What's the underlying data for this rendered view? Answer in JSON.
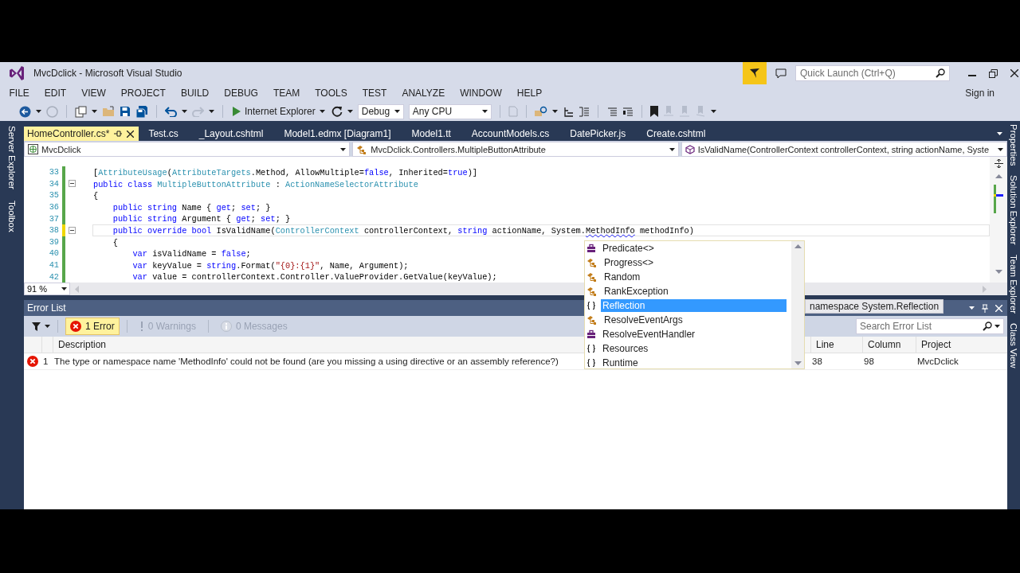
{
  "window": {
    "title": "MvcDclick - Microsoft Visual Studio"
  },
  "quick_launch": {
    "placeholder": "Quick Launch (Ctrl+Q)"
  },
  "menu": [
    "FILE",
    "EDIT",
    "VIEW",
    "PROJECT",
    "BUILD",
    "DEBUG",
    "TEAM",
    "TOOLS",
    "TEST",
    "ANALYZE",
    "WINDOW",
    "HELP"
  ],
  "sign_in": "Sign in",
  "toolbar": {
    "run_target": "Internet Explorer",
    "configuration": "Debug",
    "platform": "Any CPU"
  },
  "left_tool_tabs": [
    "Server Explorer",
    "Toolbox"
  ],
  "right_tool_tabs": [
    "Properties",
    "Solution Explorer",
    "Team Explorer",
    "Class View"
  ],
  "document_tabs": [
    {
      "label": "HomeController.cs*",
      "selected": true
    },
    {
      "label": "Test.cs",
      "selected": false
    },
    {
      "label": "_Layout.cshtml",
      "selected": false
    },
    {
      "label": "Model1.edmx [Diagram1]",
      "selected": false
    },
    {
      "label": "Model1.tt",
      "selected": false
    },
    {
      "label": "AccountModels.cs",
      "selected": false
    },
    {
      "label": "DatePicker.js",
      "selected": false
    },
    {
      "label": "Create.cshtml",
      "selected": false
    }
  ],
  "nav_bar": [
    "MvcDclick",
    "MvcDclick.Controllers.MultipleButtonAttribute",
    "IsValidName(ControllerContext controllerContext, string actionName, Syste"
  ],
  "editor": {
    "zoom": "91 %",
    "lines": [
      {
        "number": "33",
        "unsaved": false,
        "fold_marker": false,
        "current": false,
        "tokens": [
          {
            "kind": "plain",
            "text": "["
          },
          {
            "kind": "type",
            "text": "AttributeUsage"
          },
          {
            "kind": "plain",
            "text": "("
          },
          {
            "kind": "type",
            "text": "AttributeTargets"
          },
          {
            "kind": "plain",
            "text": ".Method, AllowMultiple="
          },
          {
            "kind": "kw",
            "text": "false"
          },
          {
            "kind": "plain",
            "text": ", Inherited="
          },
          {
            "kind": "kw",
            "text": "true"
          },
          {
            "kind": "plain",
            "text": ")]"
          }
        ]
      },
      {
        "number": "34",
        "unsaved": false,
        "fold_marker": true,
        "current": false,
        "tokens": [
          {
            "kind": "kw",
            "text": "public class"
          },
          {
            "kind": "type",
            "text": " MultipleButtonAttribute"
          },
          {
            "kind": "plain",
            "text": " : "
          },
          {
            "kind": "type",
            "text": "ActionNameSelectorAttribute"
          }
        ]
      },
      {
        "number": "35",
        "unsaved": false,
        "fold_marker": false,
        "current": false,
        "tokens": [
          {
            "kind": "plain",
            "text": "{"
          }
        ]
      },
      {
        "number": "36",
        "unsaved": false,
        "fold_marker": false,
        "current": false,
        "tokens": [
          {
            "kind": "kw",
            "text": "    public string"
          },
          {
            "kind": "plain",
            "text": " Name { "
          },
          {
            "kind": "kw",
            "text": "get"
          },
          {
            "kind": "plain",
            "text": "; "
          },
          {
            "kind": "kw",
            "text": "set"
          },
          {
            "kind": "plain",
            "text": "; }"
          }
        ]
      },
      {
        "number": "37",
        "unsaved": false,
        "fold_marker": false,
        "current": false,
        "tokens": [
          {
            "kind": "kw",
            "text": "    public string"
          },
          {
            "kind": "plain",
            "text": " Argument { "
          },
          {
            "kind": "kw",
            "text": "get"
          },
          {
            "kind": "plain",
            "text": "; "
          },
          {
            "kind": "kw",
            "text": "set"
          },
          {
            "kind": "plain",
            "text": "; }"
          }
        ]
      },
      {
        "number": "38",
        "unsaved": true,
        "fold_marker": true,
        "current": true,
        "tokens": [
          {
            "kind": "kw",
            "text": "    public override bool"
          },
          {
            "kind": "plain",
            "text": " IsValidName("
          },
          {
            "kind": "type",
            "text": "ControllerContext"
          },
          {
            "kind": "plain",
            "text": " controllerContext, "
          },
          {
            "kind": "kw",
            "text": "string"
          },
          {
            "kind": "plain",
            "text": " actionName, System."
          },
          {
            "kind": "error",
            "text": "MethodInfo"
          },
          {
            "kind": "plain",
            "text": " methodInfo)"
          }
        ]
      },
      {
        "number": "39",
        "unsaved": false,
        "fold_marker": false,
        "current": false,
        "tokens": [
          {
            "kind": "plain",
            "text": "    {"
          }
        ]
      },
      {
        "number": "40",
        "unsaved": false,
        "fold_marker": false,
        "current": false,
        "tokens": [
          {
            "kind": "kw",
            "text": "        var"
          },
          {
            "kind": "plain",
            "text": " isValidName = "
          },
          {
            "kind": "kw",
            "text": "false"
          },
          {
            "kind": "plain",
            "text": ";"
          }
        ]
      },
      {
        "number": "41",
        "unsaved": false,
        "fold_marker": false,
        "current": false,
        "tokens": [
          {
            "kind": "kw",
            "text": "        var"
          },
          {
            "kind": "plain",
            "text": " keyValue = "
          },
          {
            "kind": "kw",
            "text": "string"
          },
          {
            "kind": "plain",
            "text": ".Format("
          },
          {
            "kind": "str",
            "text": "\"{0}:{1}\""
          },
          {
            "kind": "plain",
            "text": ", Name, Argument);"
          }
        ]
      },
      {
        "number": "42",
        "unsaved": false,
        "fold_marker": false,
        "current": false,
        "tokens": [
          {
            "kind": "kw",
            "text": "        var"
          },
          {
            "kind": "plain",
            "text": " value = controllerContext.Controller.ValueProvider.GetValue(keyValue);"
          }
        ]
      }
    ]
  },
  "completion": {
    "items": [
      {
        "label": "Predicate<>",
        "kind": "delegate",
        "selected": false
      },
      {
        "label": "Progress<>",
        "kind": "class",
        "selected": false
      },
      {
        "label": "Random",
        "kind": "class",
        "selected": false
      },
      {
        "label": "RankException",
        "kind": "class",
        "selected": false
      },
      {
        "label": "Reflection",
        "kind": "namespace",
        "selected": true
      },
      {
        "label": "ResolveEventArgs",
        "kind": "class",
        "selected": false
      },
      {
        "label": "ResolveEventHandler",
        "kind": "delegate",
        "selected": false
      },
      {
        "label": "Resources",
        "kind": "namespace",
        "selected": false
      },
      {
        "label": "Runtime",
        "kind": "namespace",
        "selected": false
      }
    ],
    "tooltip": "namespace System.Reflection"
  },
  "error_list": {
    "title": "Error List",
    "filters": [
      {
        "label": "1 Error",
        "kind": "error",
        "selected": true
      },
      {
        "label": "0 Warnings",
        "kind": "warning",
        "selected": false
      },
      {
        "label": "0 Messages",
        "kind": "message",
        "selected": false
      }
    ],
    "search": {
      "placeholder": "Search Error List"
    },
    "columns": [
      "Description",
      "Line",
      "Column",
      "Project"
    ],
    "rows": [
      {
        "kind": "error",
        "number": "1",
        "description": "The type or namespace name 'MethodInfo' could not be found (are you missing a using directive or an assembly reference?)",
        "line": "38",
        "column": "98",
        "project": "MvcDclick"
      }
    ]
  }
}
